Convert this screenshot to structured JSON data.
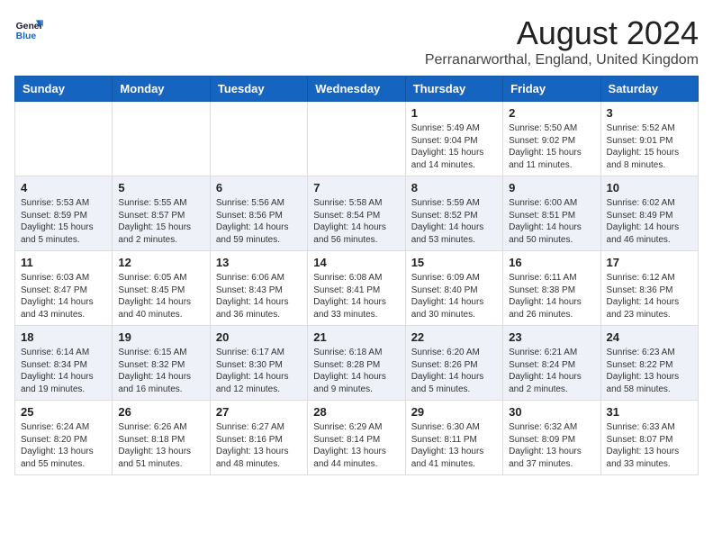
{
  "header": {
    "logo_line1": "General",
    "logo_line2": "Blue",
    "title": "August 2024",
    "subtitle": "Perranarworthal, England, United Kingdom"
  },
  "days_of_week": [
    "Sunday",
    "Monday",
    "Tuesday",
    "Wednesday",
    "Thursday",
    "Friday",
    "Saturday"
  ],
  "weeks": [
    [
      {
        "day": "",
        "info": ""
      },
      {
        "day": "",
        "info": ""
      },
      {
        "day": "",
        "info": ""
      },
      {
        "day": "",
        "info": ""
      },
      {
        "day": "1",
        "info": "Sunrise: 5:49 AM\nSunset: 9:04 PM\nDaylight: 15 hours\nand 14 minutes."
      },
      {
        "day": "2",
        "info": "Sunrise: 5:50 AM\nSunset: 9:02 PM\nDaylight: 15 hours\nand 11 minutes."
      },
      {
        "day": "3",
        "info": "Sunrise: 5:52 AM\nSunset: 9:01 PM\nDaylight: 15 hours\nand 8 minutes."
      }
    ],
    [
      {
        "day": "4",
        "info": "Sunrise: 5:53 AM\nSunset: 8:59 PM\nDaylight: 15 hours\nand 5 minutes."
      },
      {
        "day": "5",
        "info": "Sunrise: 5:55 AM\nSunset: 8:57 PM\nDaylight: 15 hours\nand 2 minutes."
      },
      {
        "day": "6",
        "info": "Sunrise: 5:56 AM\nSunset: 8:56 PM\nDaylight: 14 hours\nand 59 minutes."
      },
      {
        "day": "7",
        "info": "Sunrise: 5:58 AM\nSunset: 8:54 PM\nDaylight: 14 hours\nand 56 minutes."
      },
      {
        "day": "8",
        "info": "Sunrise: 5:59 AM\nSunset: 8:52 PM\nDaylight: 14 hours\nand 53 minutes."
      },
      {
        "day": "9",
        "info": "Sunrise: 6:00 AM\nSunset: 8:51 PM\nDaylight: 14 hours\nand 50 minutes."
      },
      {
        "day": "10",
        "info": "Sunrise: 6:02 AM\nSunset: 8:49 PM\nDaylight: 14 hours\nand 46 minutes."
      }
    ],
    [
      {
        "day": "11",
        "info": "Sunrise: 6:03 AM\nSunset: 8:47 PM\nDaylight: 14 hours\nand 43 minutes."
      },
      {
        "day": "12",
        "info": "Sunrise: 6:05 AM\nSunset: 8:45 PM\nDaylight: 14 hours\nand 40 minutes."
      },
      {
        "day": "13",
        "info": "Sunrise: 6:06 AM\nSunset: 8:43 PM\nDaylight: 14 hours\nand 36 minutes."
      },
      {
        "day": "14",
        "info": "Sunrise: 6:08 AM\nSunset: 8:41 PM\nDaylight: 14 hours\nand 33 minutes."
      },
      {
        "day": "15",
        "info": "Sunrise: 6:09 AM\nSunset: 8:40 PM\nDaylight: 14 hours\nand 30 minutes."
      },
      {
        "day": "16",
        "info": "Sunrise: 6:11 AM\nSunset: 8:38 PM\nDaylight: 14 hours\nand 26 minutes."
      },
      {
        "day": "17",
        "info": "Sunrise: 6:12 AM\nSunset: 8:36 PM\nDaylight: 14 hours\nand 23 minutes."
      }
    ],
    [
      {
        "day": "18",
        "info": "Sunrise: 6:14 AM\nSunset: 8:34 PM\nDaylight: 14 hours\nand 19 minutes."
      },
      {
        "day": "19",
        "info": "Sunrise: 6:15 AM\nSunset: 8:32 PM\nDaylight: 14 hours\nand 16 minutes."
      },
      {
        "day": "20",
        "info": "Sunrise: 6:17 AM\nSunset: 8:30 PM\nDaylight: 14 hours\nand 12 minutes."
      },
      {
        "day": "21",
        "info": "Sunrise: 6:18 AM\nSunset: 8:28 PM\nDaylight: 14 hours\nand 9 minutes."
      },
      {
        "day": "22",
        "info": "Sunrise: 6:20 AM\nSunset: 8:26 PM\nDaylight: 14 hours\nand 5 minutes."
      },
      {
        "day": "23",
        "info": "Sunrise: 6:21 AM\nSunset: 8:24 PM\nDaylight: 14 hours\nand 2 minutes."
      },
      {
        "day": "24",
        "info": "Sunrise: 6:23 AM\nSunset: 8:22 PM\nDaylight: 13 hours\nand 58 minutes."
      }
    ],
    [
      {
        "day": "25",
        "info": "Sunrise: 6:24 AM\nSunset: 8:20 PM\nDaylight: 13 hours\nand 55 minutes."
      },
      {
        "day": "26",
        "info": "Sunrise: 6:26 AM\nSunset: 8:18 PM\nDaylight: 13 hours\nand 51 minutes."
      },
      {
        "day": "27",
        "info": "Sunrise: 6:27 AM\nSunset: 8:16 PM\nDaylight: 13 hours\nand 48 minutes."
      },
      {
        "day": "28",
        "info": "Sunrise: 6:29 AM\nSunset: 8:14 PM\nDaylight: 13 hours\nand 44 minutes."
      },
      {
        "day": "29",
        "info": "Sunrise: 6:30 AM\nSunset: 8:11 PM\nDaylight: 13 hours\nand 41 minutes."
      },
      {
        "day": "30",
        "info": "Sunrise: 6:32 AM\nSunset: 8:09 PM\nDaylight: 13 hours\nand 37 minutes."
      },
      {
        "day": "31",
        "info": "Sunrise: 6:33 AM\nSunset: 8:07 PM\nDaylight: 13 hours\nand 33 minutes."
      }
    ]
  ]
}
